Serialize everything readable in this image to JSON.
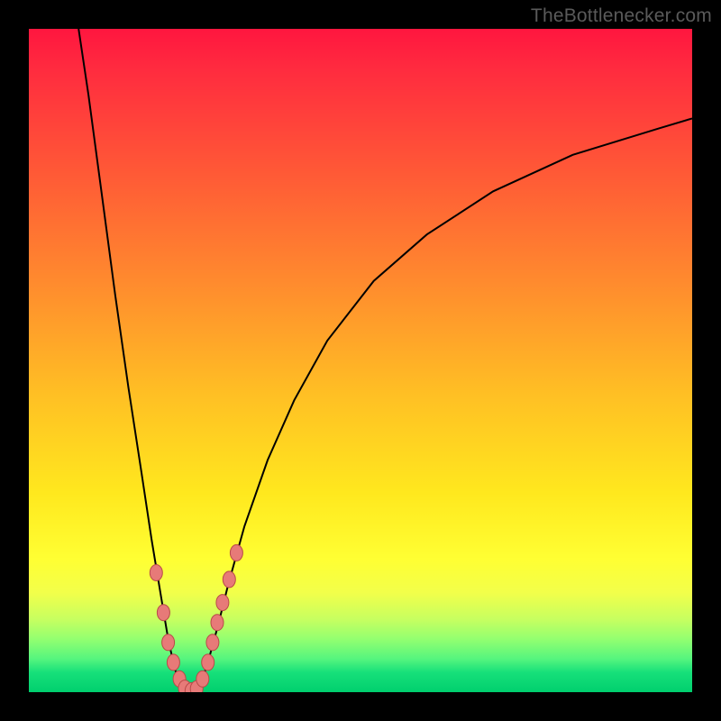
{
  "watermark": {
    "text": "TheBottlenecker.com"
  },
  "colors": {
    "black": "#000000",
    "curve": "#000000",
    "marker_fill": "#e77a78",
    "marker_stroke": "#b94a48",
    "gradient_top": "#ff163f",
    "gradient_bottom": "#00cf6e"
  },
  "chart_data": {
    "type": "line",
    "title": "",
    "xlabel": "",
    "ylabel": "",
    "xlim": [
      0,
      100
    ],
    "ylim": [
      0,
      100
    ],
    "grid": false,
    "legend": false,
    "curve_points": [
      {
        "x": 7.5,
        "y": 100.0
      },
      {
        "x": 9.0,
        "y": 90.0
      },
      {
        "x": 11.0,
        "y": 75.0
      },
      {
        "x": 13.0,
        "y": 60.0
      },
      {
        "x": 15.0,
        "y": 46.0
      },
      {
        "x": 17.0,
        "y": 33.0
      },
      {
        "x": 18.5,
        "y": 23.0
      },
      {
        "x": 20.0,
        "y": 14.0
      },
      {
        "x": 21.0,
        "y": 8.0
      },
      {
        "x": 22.0,
        "y": 3.5
      },
      {
        "x": 23.0,
        "y": 1.0
      },
      {
        "x": 24.0,
        "y": 0.2
      },
      {
        "x": 25.0,
        "y": 0.2
      },
      {
        "x": 26.0,
        "y": 1.5
      },
      {
        "x": 27.0,
        "y": 4.5
      },
      {
        "x": 28.5,
        "y": 10.0
      },
      {
        "x": 30.0,
        "y": 16.0
      },
      {
        "x": 32.5,
        "y": 25.0
      },
      {
        "x": 36.0,
        "y": 35.0
      },
      {
        "x": 40.0,
        "y": 44.0
      },
      {
        "x": 45.0,
        "y": 53.0
      },
      {
        "x": 52.0,
        "y": 62.0
      },
      {
        "x": 60.0,
        "y": 69.0
      },
      {
        "x": 70.0,
        "y": 75.5
      },
      {
        "x": 82.0,
        "y": 81.0
      },
      {
        "x": 95.0,
        "y": 85.0
      },
      {
        "x": 100.0,
        "y": 86.5
      }
    ],
    "markers": [
      {
        "x": 19.2,
        "y": 18.0
      },
      {
        "x": 20.3,
        "y": 12.0
      },
      {
        "x": 21.0,
        "y": 7.5
      },
      {
        "x": 21.8,
        "y": 4.5
      },
      {
        "x": 22.7,
        "y": 2.0
      },
      {
        "x": 23.5,
        "y": 0.6
      },
      {
        "x": 24.5,
        "y": 0.2
      },
      {
        "x": 25.3,
        "y": 0.5
      },
      {
        "x": 26.2,
        "y": 2.0
      },
      {
        "x": 27.0,
        "y": 4.5
      },
      {
        "x": 27.7,
        "y": 7.5
      },
      {
        "x": 28.4,
        "y": 10.5
      },
      {
        "x": 29.2,
        "y": 13.5
      },
      {
        "x": 30.2,
        "y": 17.0
      },
      {
        "x": 31.3,
        "y": 21.0
      }
    ]
  }
}
